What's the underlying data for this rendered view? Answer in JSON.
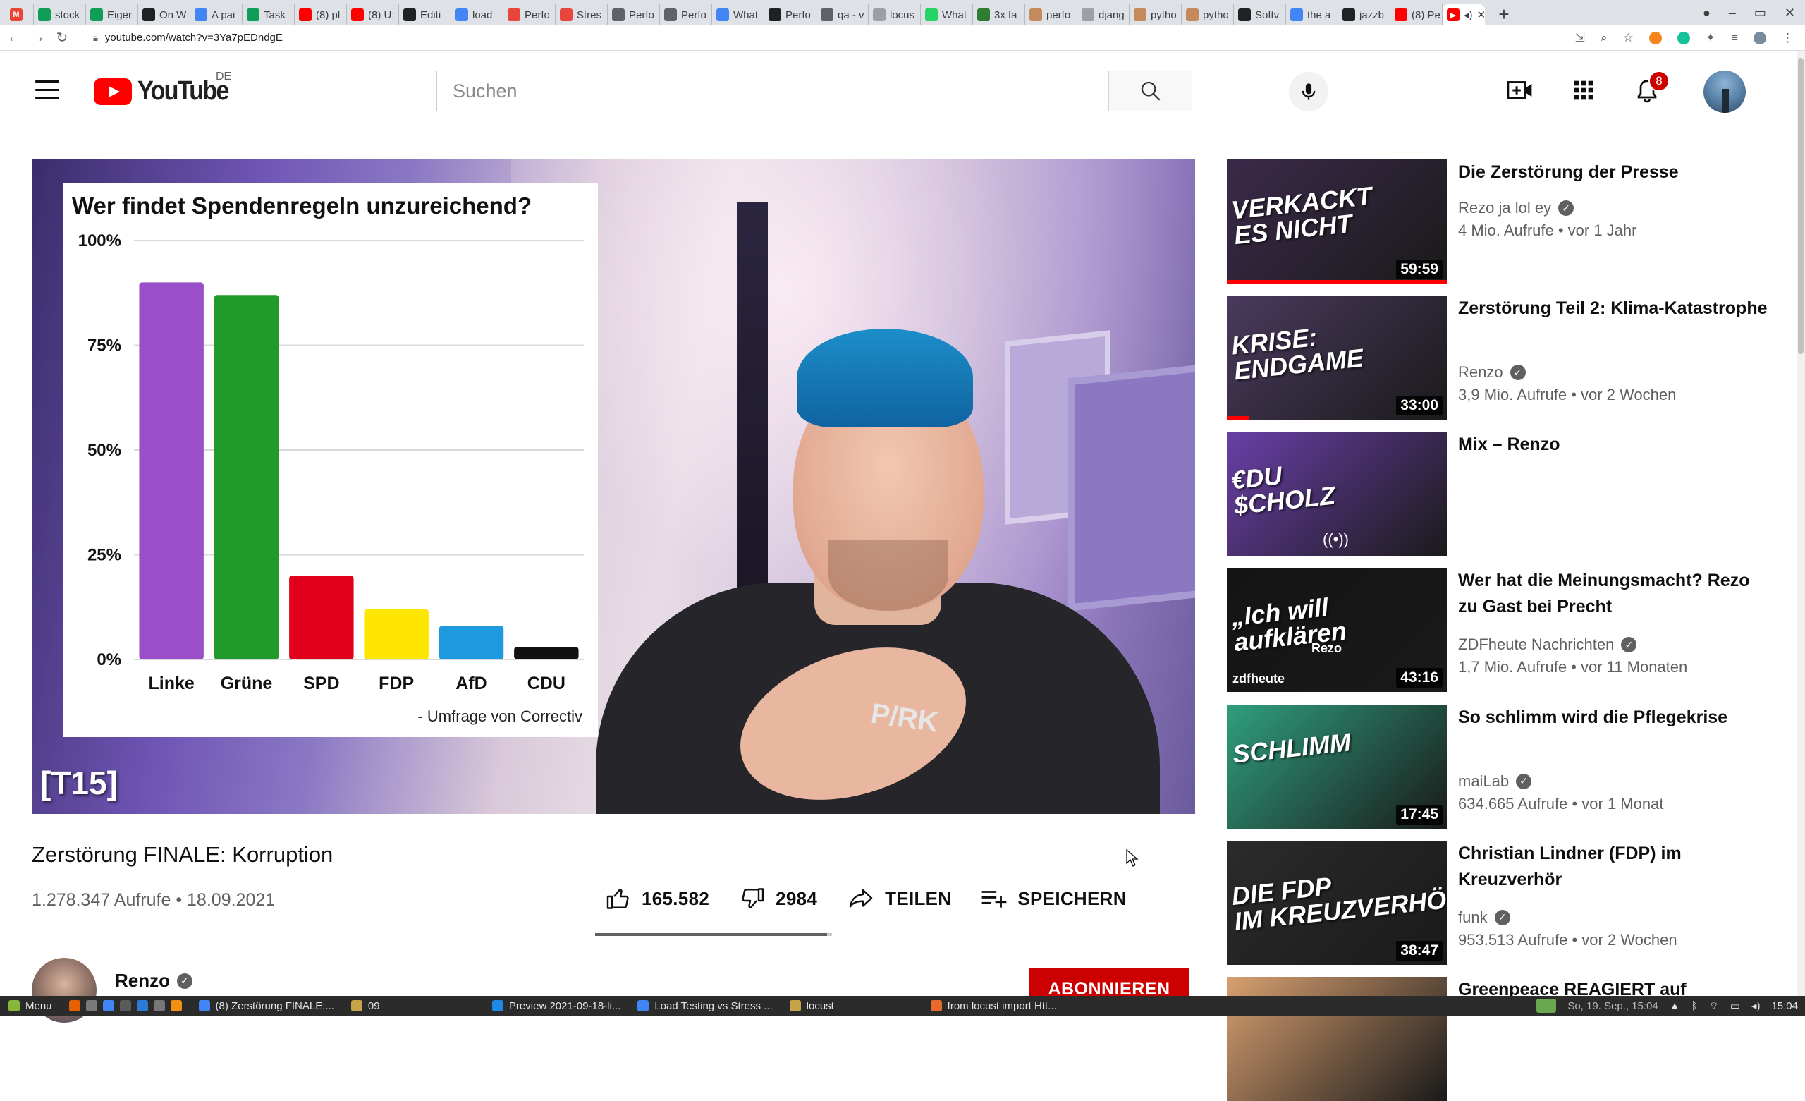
{
  "browser": {
    "tabs": [
      {
        "label": "stock",
        "color": "#0f9d58"
      },
      {
        "label": "Eiger",
        "color": "#0f9d58"
      },
      {
        "label": "On W",
        "color": "#202124"
      },
      {
        "label": "A pai",
        "color": "#4285f4"
      },
      {
        "label": "Task",
        "color": "#0f9d58"
      },
      {
        "label": "(8) pl",
        "color": "#ff0000"
      },
      {
        "label": "(8) U:",
        "color": "#ff0000"
      },
      {
        "label": "Editi",
        "color": "#202124"
      },
      {
        "label": "load",
        "color": "#4285f4"
      },
      {
        "label": "Perfo",
        "color": "#e8453c"
      },
      {
        "label": "Stres",
        "color": "#e8453c"
      },
      {
        "label": "Perfo",
        "color": "#5f6368"
      },
      {
        "label": "Perfo",
        "color": "#5f6368"
      },
      {
        "label": "What",
        "color": "#4285f4"
      },
      {
        "label": "Perfo",
        "color": "#202124"
      },
      {
        "label": "qa - v",
        "color": "#5f6368"
      },
      {
        "label": "locus",
        "color": "#9aa0a6"
      },
      {
        "label": "What",
        "color": "#25d366"
      },
      {
        "label": "3x fa",
        "color": "#2e7d32"
      },
      {
        "label": "perfo",
        "color": "#c58a5b"
      },
      {
        "label": "djang",
        "color": "#9aa0a6"
      },
      {
        "label": "pytho",
        "color": "#c58a5b"
      },
      {
        "label": "pytho",
        "color": "#c58a5b"
      },
      {
        "label": "Softv",
        "color": "#202124"
      },
      {
        "label": "the a",
        "color": "#4285f4"
      },
      {
        "label": "jazzb",
        "color": "#202124"
      },
      {
        "label": "(8) Pe",
        "color": "#ff0000"
      }
    ],
    "active_tab_color": "#ff0000",
    "url": "youtube.com/watch?v=3Ya7pEDndgE"
  },
  "youtube": {
    "logo_text": "YouTube",
    "country": "DE",
    "search_placeholder": "Suchen",
    "notifications_count": "8"
  },
  "video": {
    "chart_overlay": {
      "chart_data": {
        "type": "bar",
        "title": "Wer findet Spendenregeln unzureichend?",
        "categories": [
          "Linke",
          "Grüne",
          "SPD",
          "FDP",
          "AfD",
          "CDU"
        ],
        "values": [
          90,
          87,
          20,
          12,
          8,
          3
        ],
        "colors": [
          "#9a4fc9",
          "#1f9a2b",
          "#e0001b",
          "#ffe600",
          "#1e9be0",
          "#111111"
        ],
        "yticks": [
          "0%",
          "25%",
          "50%",
          "75%",
          "100%"
        ],
        "ylim": [
          0,
          100
        ],
        "grid": true,
        "source": "- Umfrage von Correctiv"
      }
    },
    "chapter_tag": "[T15]",
    "title": "Zerstörung FINALE: Korruption",
    "meta": "1.278.347 Aufrufe • 18.09.2021",
    "likes": "165.582",
    "dislikes": "2984",
    "share_label": "TEILEN",
    "save_label": "SPEICHERN",
    "more_label": "...",
    "sentiment_like_ratio": 0.98,
    "shirt_text": "P/RK",
    "channel": "Renzo",
    "subscribe_label": "ABONNIEREN"
  },
  "recommendations": [
    {
      "title": "Die Zerstörung der Presse",
      "channel": "Rezo ja lol ey",
      "verified": true,
      "stats": "4 Mio. Aufrufe • vor 1 Jahr",
      "duration": "59:59",
      "thumb_text": "VERKACKT\nES NICHT",
      "thumb_color": "#3b2a4a",
      "progress": 1.0
    },
    {
      "title": "Zerstörung Teil 2: Klima-Katastrophe",
      "channel": "Renzo",
      "verified": true,
      "stats": "3,9 Mio. Aufrufe • vor 2 Wochen",
      "duration": "33:00",
      "thumb_text": "KRISE:\nENDGAME",
      "thumb_color": "#4a3a5e",
      "progress": 0.1
    },
    {
      "title": "Mix – Renzo",
      "channel": "",
      "verified": false,
      "stats": "",
      "duration": "",
      "thumb_text": "€DU\n$CHOLZ",
      "thumb_color": "#6a3fa8",
      "progress": 0,
      "live": true
    },
    {
      "title": "Wer hat die Meinungsmacht? Rezo zu Gast bei Precht",
      "channel": "ZDFheute Nachrichten",
      "verified": true,
      "stats": "1,7 Mio. Aufrufe • vor 11 Monaten",
      "duration": "43:16",
      "thumb_text": "„Ich will\naufklären",
      "thumb_color": "#141414",
      "progress": 0,
      "thumb_sub": "Rezo",
      "thumb_brand": "zdfheute"
    },
    {
      "title": "So schlimm wird die Pflegekrise",
      "channel": "maiLab",
      "verified": true,
      "stats": "634.665 Aufrufe • vor 1 Monat",
      "duration": "17:45",
      "thumb_text": "SCHLIMM",
      "thumb_color": "#2f9f7e",
      "progress": 0
    },
    {
      "title": "Christian Lindner (FDP) im Kreuzverhör",
      "channel": "funk",
      "verified": true,
      "stats": "953.513 Aufrufe • vor 2 Wochen",
      "duration": "38:47",
      "thumb_text": "DIE FDP\nIM KREUZVERHÖR",
      "thumb_color": "#2b2b2b",
      "progress": 0
    },
    {
      "title": "Greenpeace REAGIERT auf",
      "channel": "",
      "verified": false,
      "stats": "",
      "duration": "",
      "thumb_text": "",
      "thumb_color": "#d8a070",
      "progress": 0
    }
  ],
  "taskbar": {
    "menu_label": "Menu",
    "items": [
      {
        "label": "(8) Zerstörung FINALE:...",
        "color": "#4285f4"
      },
      {
        "label": "09",
        "color": "#c7a34a"
      },
      {
        "label": "Preview 2021-09-18-li...",
        "color": "#1e88e5"
      },
      {
        "label": "Load Testing vs Stress ...",
        "color": "#4285f4"
      },
      {
        "label": "locust",
        "color": "#c7a34a"
      },
      {
        "label": "from locust import Htt...",
        "color": "#e86a2d"
      }
    ],
    "datetime": "So, 19. Sep., 15:04",
    "clock": "15:04"
  }
}
